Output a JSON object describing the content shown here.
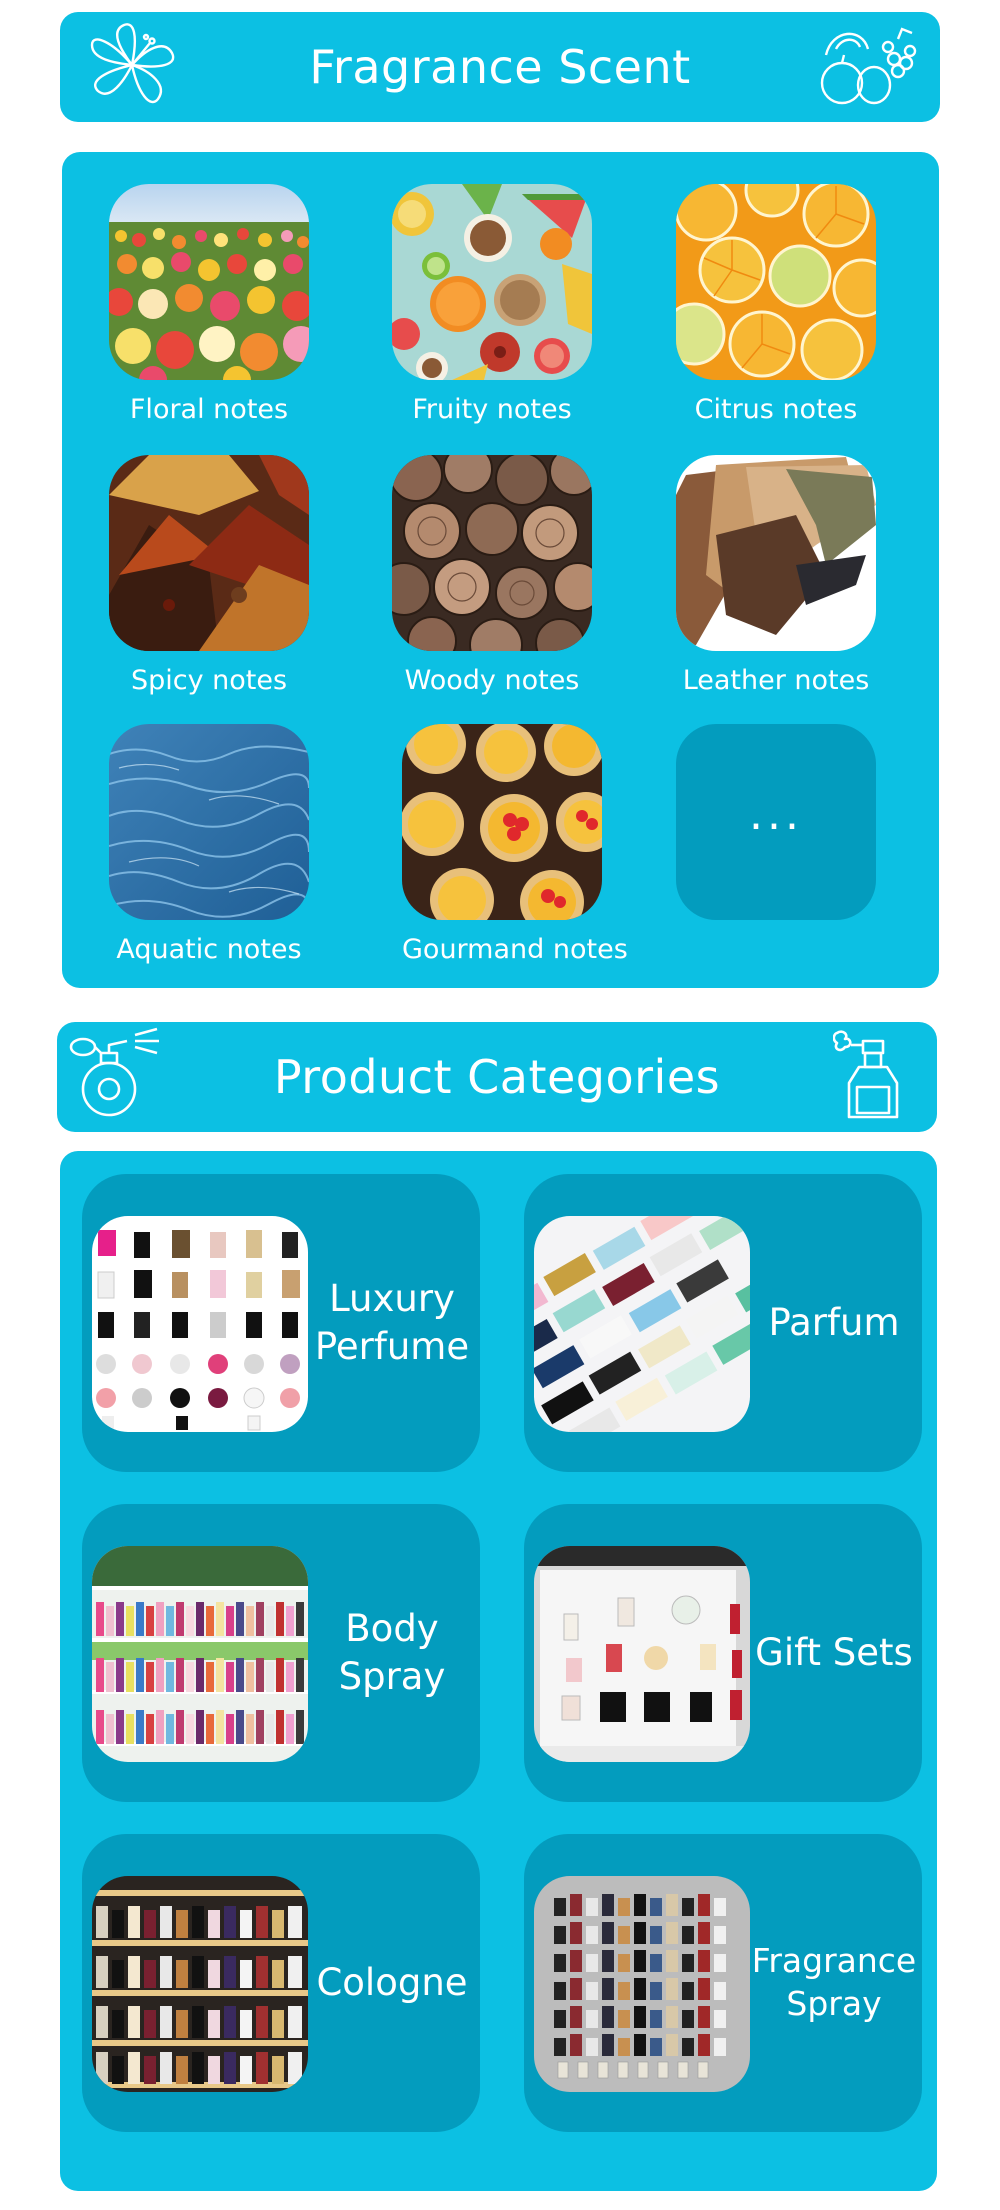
{
  "scent_header": {
    "title": "Fragrance Scent",
    "left_icon": "hibiscus-icon",
    "right_icon": "fruits-icon"
  },
  "notes": [
    {
      "label": "Floral notes",
      "image": "flower-field"
    },
    {
      "label": "Fruity notes",
      "image": "fruit-slices"
    },
    {
      "label": "Citrus notes",
      "image": "citrus-slices"
    },
    {
      "label": "Spicy notes",
      "image": "spice-piles"
    },
    {
      "label": "Woody notes",
      "image": "wood-logs"
    },
    {
      "label": "Leather notes",
      "image": "leather-hides"
    },
    {
      "label": "Aquatic notes",
      "image": "water-surface"
    },
    {
      "label": "Gourmand  notes",
      "image": "fruit-tarts"
    }
  ],
  "more": {
    "label": "..."
  },
  "category_header": {
    "title": "Product Categories",
    "left_icon": "perfume-bottle-icon",
    "right_icon": "spray-bottle-icon"
  },
  "categories": [
    {
      "label": "Luxury Perfume",
      "image": "perfume-grid"
    },
    {
      "label": "Parfum",
      "image": "perfume-boxes"
    },
    {
      "label": "Body Spray",
      "image": "store-shelves"
    },
    {
      "label": "Gift Sets",
      "image": "bottle-display"
    },
    {
      "label": "Cologne",
      "image": "cologne-shelves"
    },
    {
      "label": "Fragrance Spray",
      "image": "bottle-collection"
    }
  ],
  "colors": {
    "panel": "#0cc0e3",
    "tile": "#039cbe",
    "text": "#ffffff"
  }
}
